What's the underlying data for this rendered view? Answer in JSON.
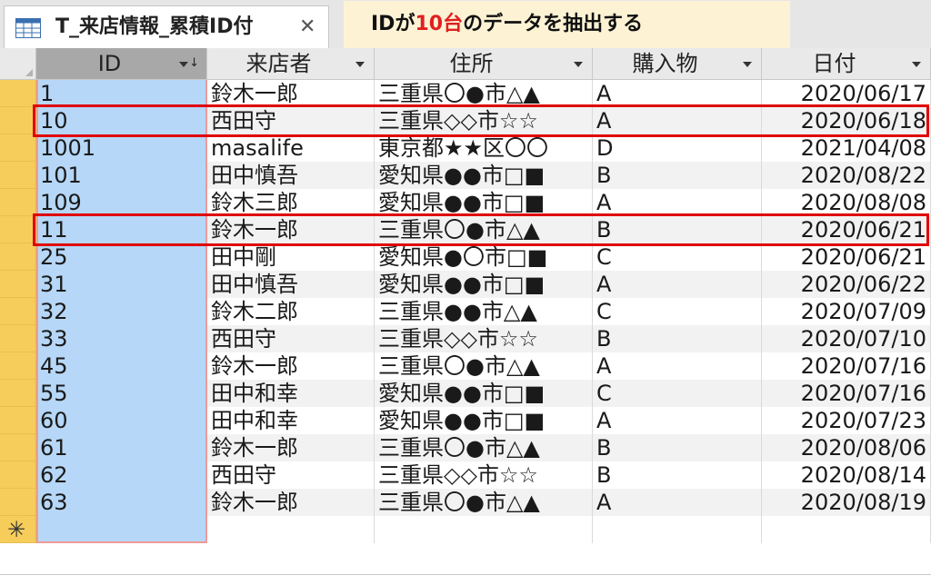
{
  "tab": {
    "title": "T_来店情報_累積ID付",
    "close_glyph": "✕",
    "icon": "datasheet-table-icon"
  },
  "callout": {
    "prefix": "IDが",
    "highlight": "10台",
    "suffix": "のデータを抽出する"
  },
  "colors": {
    "selector": "#f6cd5a",
    "id_column": "#b6d7f7",
    "highlight_box": "#e00000",
    "callout_bg": "#fdf3d4"
  },
  "columns": [
    {
      "key": "id",
      "label": "ID",
      "sort_indicator": "↓"
    },
    {
      "key": "visitor",
      "label": "来店者"
    },
    {
      "key": "address",
      "label": "住所"
    },
    {
      "key": "item",
      "label": "購入物"
    },
    {
      "key": "date",
      "label": "日付"
    }
  ],
  "rows": [
    [
      "1",
      "鈴木一郎",
      "三重県〇●市△▲",
      "A",
      "2020/06/17"
    ],
    [
      "10",
      "西田守",
      "三重県◇◇市☆☆",
      "A",
      "2020/06/18"
    ],
    [
      "1001",
      "masalife",
      "東京都★★区〇〇",
      "D",
      "2021/04/08"
    ],
    [
      "101",
      "田中慎吾",
      "愛知県●●市□■",
      "B",
      "2020/08/22"
    ],
    [
      "109",
      "鈴木三郎",
      "愛知県●●市□■",
      "A",
      "2020/08/08"
    ],
    [
      "11",
      "鈴木一郎",
      "三重県〇●市△▲",
      "B",
      "2020/06/21"
    ],
    [
      "25",
      "田中剛",
      "愛知県●〇市□■",
      "C",
      "2020/06/21"
    ],
    [
      "31",
      "田中慎吾",
      "愛知県●●市□■",
      "A",
      "2020/06/22"
    ],
    [
      "32",
      "鈴木二郎",
      "三重県●●市△▲",
      "C",
      "2020/07/09"
    ],
    [
      "33",
      "西田守",
      "三重県◇◇市☆☆",
      "B",
      "2020/07/10"
    ],
    [
      "45",
      "鈴木一郎",
      "三重県〇●市△▲",
      "A",
      "2020/07/16"
    ],
    [
      "55",
      "田中和幸",
      "愛知県●●市□■",
      "C",
      "2020/07/16"
    ],
    [
      "60",
      "田中和幸",
      "愛知県●●市□■",
      "A",
      "2020/07/23"
    ],
    [
      "61",
      "鈴木一郎",
      "三重県〇●市△▲",
      "B",
      "2020/08/06"
    ],
    [
      "62",
      "西田守",
      "三重県◇◇市☆☆",
      "B",
      "2020/08/14"
    ],
    [
      "63",
      "鈴木一郎",
      "三重県〇●市△▲",
      "A",
      "2020/08/19"
    ]
  ],
  "highlighted_rows": [
    1,
    5
  ],
  "new_record_marker": "✳"
}
